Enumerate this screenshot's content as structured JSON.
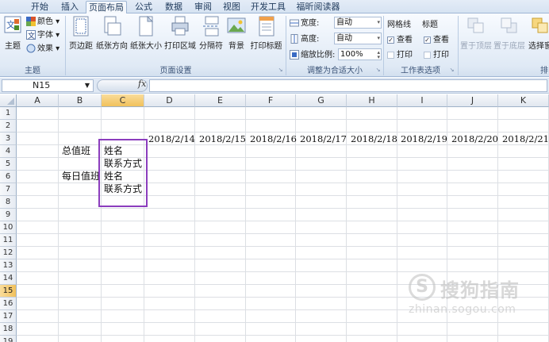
{
  "ribbon_tabs": [
    "开始",
    "插入",
    "页面布局",
    "公式",
    "数据",
    "审阅",
    "视图",
    "开发工具",
    "福昕阅读器"
  ],
  "active_tab": "页面布局",
  "theme_group": {
    "label": "主题",
    "theme_button": "主题",
    "colors": "颜色",
    "fonts": "字体",
    "effects": "效果"
  },
  "page_setup_group": {
    "label": "页面设置",
    "margins": "页边距",
    "orientation": "纸张方向",
    "size": "纸张大小",
    "print_area": "打印区域",
    "breaks": "分隔符",
    "background": "背景",
    "print_titles": "打印标题"
  },
  "scale_group": {
    "label": "调整为合适大小",
    "width_label": "宽度:",
    "width_value": "自动",
    "height_label": "高度:",
    "height_value": "自动",
    "scale_label": "缩放比例:",
    "scale_value": "100%"
  },
  "sheet_options_group": {
    "label": "工作表选项",
    "gridlines": "网格线",
    "headings": "标题",
    "view": "查看",
    "print": "打印"
  },
  "arrange_group": {
    "bring_forward": "置于顶层",
    "send_backward": "置于底层",
    "selection_pane": "选择窗",
    "label_partial": "排"
  },
  "formula_bar": {
    "name_box": "N15",
    "fx": "fx",
    "formula": ""
  },
  "columns": [
    "A",
    "B",
    "C",
    "D",
    "E",
    "F",
    "G",
    "H",
    "I",
    "J",
    "K"
  ],
  "selected_column": "C",
  "rows": [
    "1",
    "2",
    "3",
    "4",
    "5",
    "6",
    "7",
    "8",
    "9",
    "10",
    "11",
    "12",
    "13",
    "14",
    "15",
    "16",
    "17",
    "18",
    "19"
  ],
  "selected_row": "15",
  "cells": {
    "D3": "2018/2/14",
    "E3": "2018/2/15",
    "F3": "2018/2/16",
    "G3": "2018/2/17",
    "H3": "2018/2/18",
    "I3": "2018/2/19",
    "J3": "2018/2/20",
    "K3": "2018/2/21",
    "B4": "总值班",
    "C4": "姓名",
    "C5": "联系方式",
    "B6": "每日值班",
    "C6": "姓名",
    "C7": "联系方式"
  },
  "watermark": {
    "mark": "S",
    "brand": "搜狗指南",
    "url": "zhinan.sogou.com"
  },
  "colors": {
    "highlight_box": "#8b3dbd",
    "selected_header": "#f1c15c",
    "ribbon_blue": "#dfe9f5"
  }
}
